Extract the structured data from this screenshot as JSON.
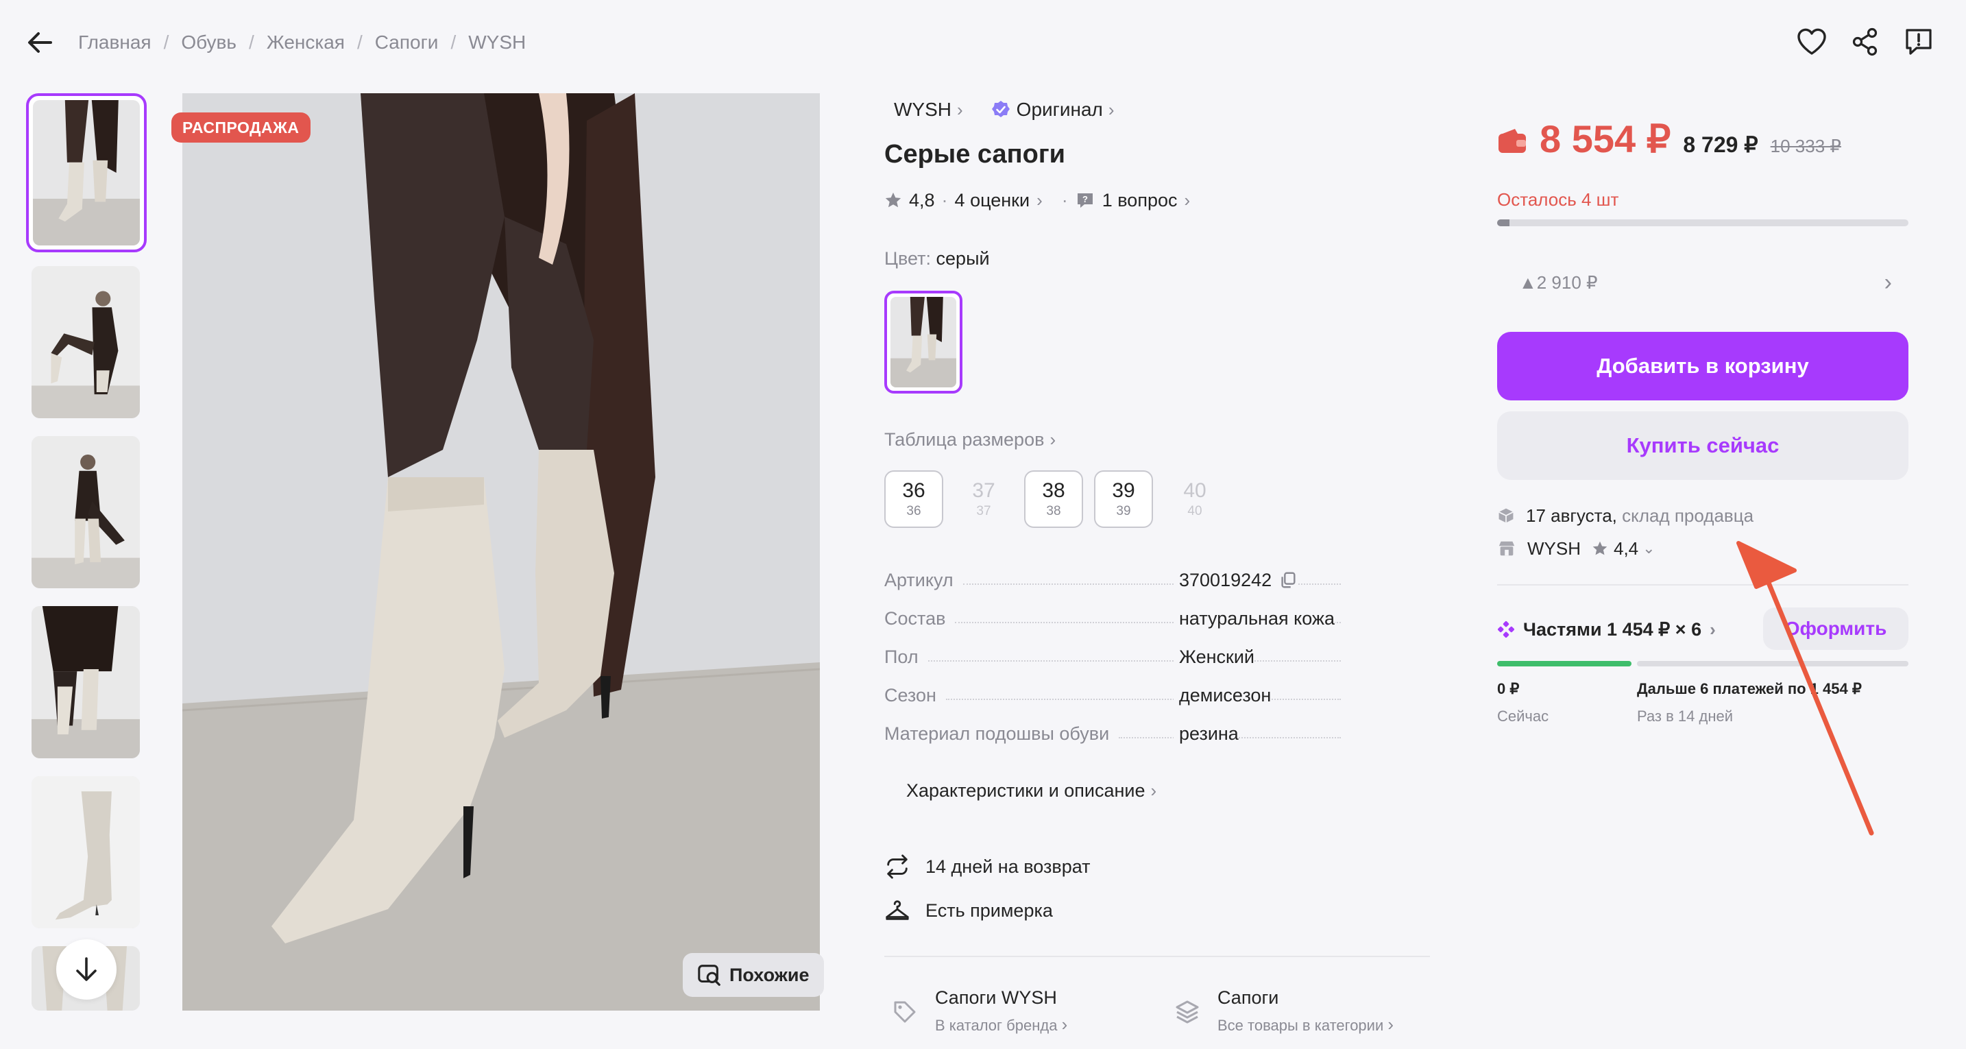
{
  "breadcrumbs": [
    "Главная",
    "Обувь",
    "Женская",
    "Сапоги",
    "WYSH"
  ],
  "header_icons": [
    "heart-icon",
    "share-icon",
    "report-icon"
  ],
  "gallery": {
    "sale_badge": "РАСПРОДАЖА",
    "similar_label": "Похожие"
  },
  "product": {
    "brand": "WYSH",
    "original_label": "Оригинал",
    "title": "Серые сапоги",
    "rating": "4,8",
    "reviews": "4 оценки",
    "questions": "1 вопрос",
    "color_label": "Цвет:",
    "color_value": "серый",
    "size_table_label": "Таблица размеров",
    "sizes": [
      {
        "ru": "36",
        "eu": "36",
        "available": true
      },
      {
        "ru": "37",
        "eu": "37",
        "available": false
      },
      {
        "ru": "38",
        "eu": "38",
        "available": true
      },
      {
        "ru": "39",
        "eu": "39",
        "available": true
      },
      {
        "ru": "40",
        "eu": "40",
        "available": false
      }
    ],
    "attributes": [
      {
        "key": "Артикул",
        "value": "370019242"
      },
      {
        "key": "Состав",
        "value": "натуральная кожа"
      },
      {
        "key": "Пол",
        "value": "Женский"
      },
      {
        "key": "Сезон",
        "value": "демисезон"
      },
      {
        "key": "Материал подошвы обуви",
        "value": "резина"
      }
    ],
    "description_link": "Характеристики и описание",
    "features": [
      "14 дней на возврат",
      "Есть примерка"
    ],
    "catalog_links": [
      {
        "title": "Сапоги WYSH",
        "subtitle": "В каталог бренда"
      },
      {
        "title": "Сапоги",
        "subtitle": "Все товары в категории"
      }
    ]
  },
  "purchase": {
    "price_wallet": "8 554 ₽",
    "price": "8 729 ₽",
    "price_old": "10 333 ₽",
    "stock_text": "Осталось 4 шт",
    "stock_level": 0.03,
    "discount_text": "▲2 910 ₽",
    "add_to_cart": "Добавить в корзину",
    "buy_now": "Купить сейчас",
    "delivery_date": "17 августа,",
    "delivery_source": "склад продавца",
    "seller": "WYSH",
    "seller_rating": "4,4",
    "installments": "Частями 1 454 ₽ × 6",
    "order_button": "Оформить",
    "pay_now_amount": "0 ₽",
    "pay_now_label": "Сейчас",
    "pay_later_amount": "Дальше 6 платежей по 1 454 ₽",
    "pay_later_label": "Раз в 14 дней"
  },
  "colors": {
    "accent": "#a73afd",
    "sale": "#e2564e",
    "installment_done": "#3fbd6b",
    "annotation_arrow": "#ea5a3f"
  }
}
